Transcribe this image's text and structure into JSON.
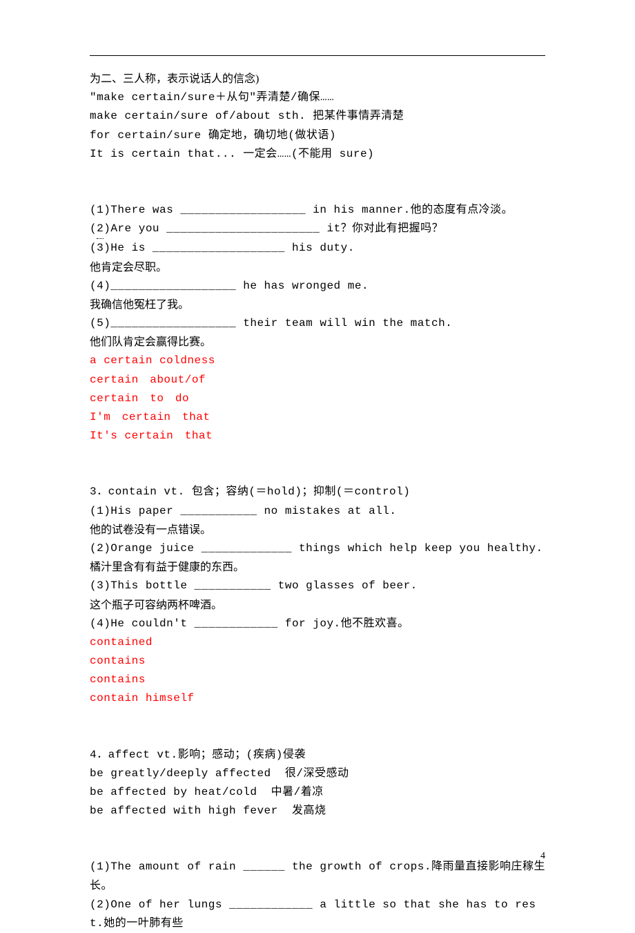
{
  "lines": {
    "l1": "为二、三人称，表示说话人的信念)",
    "l2": "\"make certain/sure＋从句\"弄清楚/确保……",
    "l3": "make certain/sure of/about sth. 把某件事情弄清楚",
    "l4": "for certain/sure 确定地，确切地(做状语)",
    "l5": "It is certain that... 一定会……(不能用 sure)",
    "l6": "(1)There was __________________ in his manner.他的态度有点冷淡。",
    "l7a": "(",
    "l7b": "2",
    "l7c": ")Are you ______________________ it？你对此有把握吗？",
    "l8": "(3)He is ___________________ his duty.",
    "l9": "他肯定会尽职。",
    "l10": "(4)__________________ he has wronged me.",
    "l11": "我确信他冤枉了我。",
    "l12": "(5)__________________ their team will win the match.",
    "l13": "他们队肯定会赢得比赛。",
    "r1": "a certain coldness",
    "r2": "certain　about/of",
    "r3": "certain　to　do",
    "r4": "I'm　certain　that",
    "r5": "It's certain　that",
    "l14": "3．contain vt. 包含；容纳(＝hold)；抑制(＝control)",
    "l15": "(1)His paper ___________ no mistakes at all.",
    "l16": "他的试卷没有一点错误。",
    "l17": "(2)Orange juice _____________ things which help keep you healthy.",
    "l18": "橘汁里含有有益于健康的东西。",
    "l19": "(3)This bottle ___________ two glasses of beer.",
    "l20": "这个瓶子可容纳两杯啤酒。",
    "l21": "(4)He couldn't ____________ for joy.他不胜欢喜。",
    "r6": "contained",
    "r7": "contains",
    "r8": "contains",
    "r9": "contain himself",
    "l22": "4．affect vt.影响；感动；(疾病)侵袭",
    "l23": "be greatly/deeply affected  很/深受感动",
    "l24": "be affected by heat/cold  中暑/着凉",
    "l25": "be affected with high fever  发高烧",
    "l26": "(1)The amount of rain ______ the growth of crops.降雨量直接影响庄稼生长。",
    "l27": "(2)One of her lungs ____________ a little so that she has to rest.她的一叶肺有些"
  },
  "pageNumber": "4"
}
